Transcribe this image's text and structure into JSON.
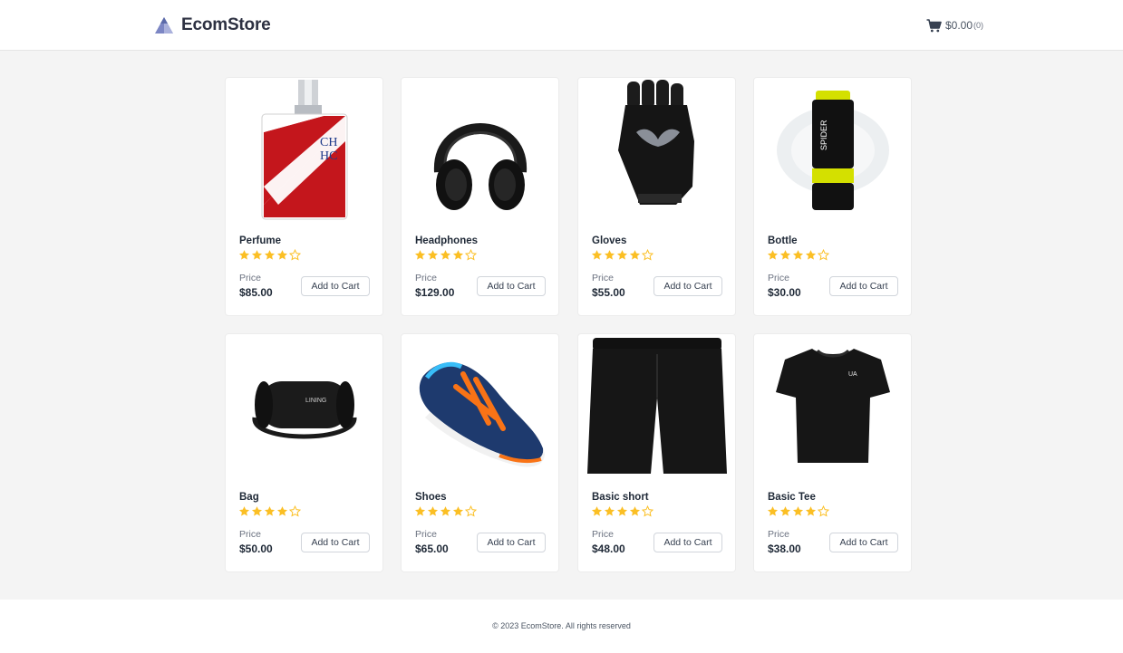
{
  "header": {
    "logo_text": "EcomStore",
    "cart_total": "$0.00",
    "cart_count": "(0)"
  },
  "products": [
    {
      "name": "Perfume",
      "rating": 4,
      "max_rating": 5,
      "price_label": "Price",
      "price": "$85.00",
      "button_label": "Add to Cart"
    },
    {
      "name": "Headphones",
      "rating": 4,
      "max_rating": 5,
      "price_label": "Price",
      "price": "$129.00",
      "button_label": "Add to Cart"
    },
    {
      "name": "Gloves",
      "rating": 4,
      "max_rating": 5,
      "price_label": "Price",
      "price": "$55.00",
      "button_label": "Add to Cart"
    },
    {
      "name": "Bottle",
      "rating": 4,
      "max_rating": 5,
      "price_label": "Price",
      "price": "$30.00",
      "button_label": "Add to Cart"
    },
    {
      "name": "Bag",
      "rating": 4,
      "max_rating": 5,
      "price_label": "Price",
      "price": "$50.00",
      "button_label": "Add to Cart"
    },
    {
      "name": "Shoes",
      "rating": 4,
      "max_rating": 5,
      "price_label": "Price",
      "price": "$65.00",
      "button_label": "Add to Cart"
    },
    {
      "name": "Basic short",
      "rating": 4,
      "max_rating": 5,
      "price_label": "Price",
      "price": "$48.00",
      "button_label": "Add to Cart"
    },
    {
      "name": "Basic Tee",
      "rating": 4,
      "max_rating": 5,
      "price_label": "Price",
      "price": "$38.00",
      "button_label": "Add to Cart"
    }
  ],
  "footer": {
    "copyright": "© 2023 EcomStore. All rights reserved"
  },
  "colors": {
    "star": "#fbbf24",
    "accent": "#2d3142"
  },
  "icons": {
    "logo": "pyramid-logo-icon",
    "cart": "shopping-cart-icon",
    "star": "star-icon"
  }
}
